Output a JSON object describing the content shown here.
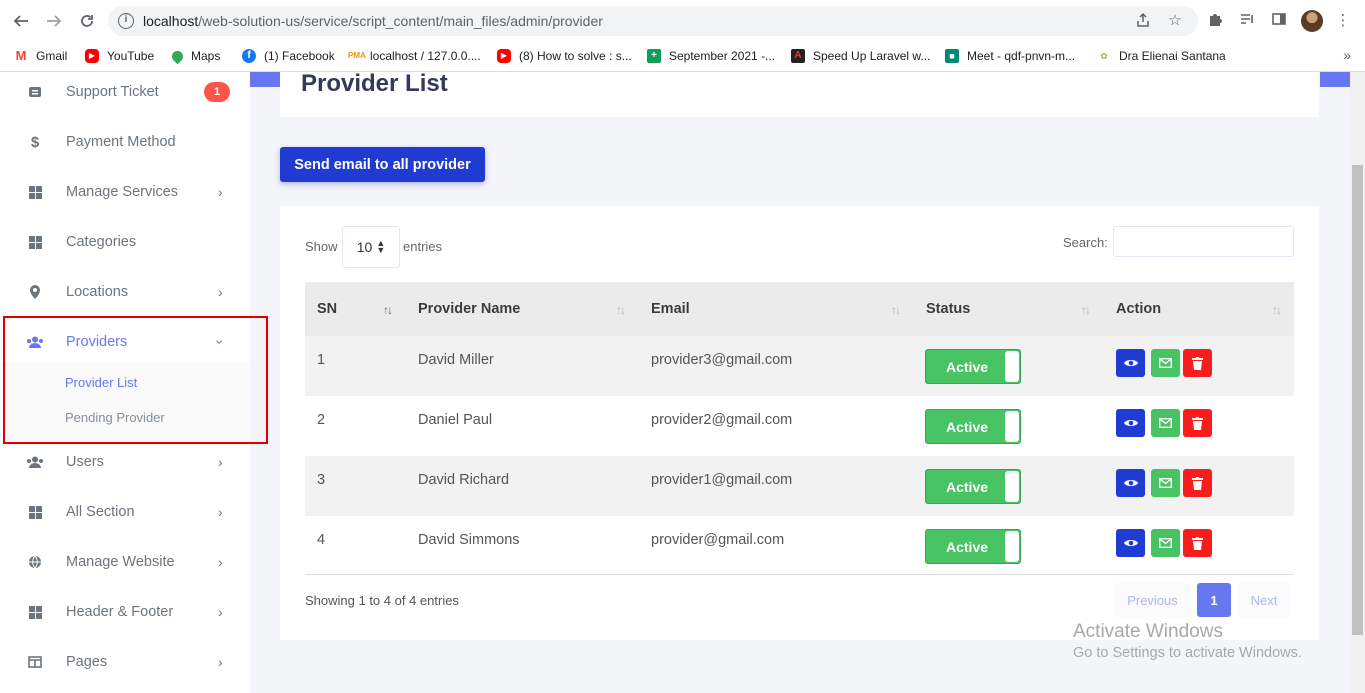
{
  "browser": {
    "url_host": "localhost",
    "url_path": "/web-solution-us/service/script_content/main_files/admin/provider",
    "bookmarks": [
      {
        "label": "Gmail",
        "icon": "gmail-icon",
        "color": "#ea4335"
      },
      {
        "label": "YouTube",
        "icon": "youtube-icon",
        "color": "#ff0000"
      },
      {
        "label": "Maps",
        "icon": "maps-icon",
        "color": "#34a853"
      },
      {
        "label": "(1) Facebook",
        "icon": "facebook-icon",
        "color": "#1877f2"
      },
      {
        "label": "localhost / 127.0.0....",
        "icon": "phpmyadmin-icon",
        "color": "#f29111"
      },
      {
        "label": "(8) How to solve : s...",
        "icon": "youtube-icon",
        "color": "#ff0000"
      },
      {
        "label": "September 2021 -...",
        "icon": "sheets-icon",
        "color": "#0f9d58"
      },
      {
        "label": "Speed Up Laravel w...",
        "icon": "laravel-icon",
        "color": "#222222"
      },
      {
        "label": "Meet - qdf-pnvn-m...",
        "icon": "meet-icon",
        "color": "#00897b"
      },
      {
        "label": "Dra Elienai Santana",
        "icon": "site-icon",
        "color": "#8bc34a"
      }
    ]
  },
  "sidebar": {
    "items": [
      {
        "label": "Support Ticket",
        "icon": "ticket-icon",
        "badge": "1"
      },
      {
        "label": "Payment Method",
        "icon": "dollar-icon"
      },
      {
        "label": "Manage Services",
        "icon": "grid-icon"
      },
      {
        "label": "Categories",
        "icon": "grid-icon"
      },
      {
        "label": "Locations",
        "icon": "map-marker-icon"
      },
      {
        "label": "Providers",
        "icon": "users-icon"
      },
      {
        "label": "Users",
        "icon": "users-icon"
      },
      {
        "label": "All Section",
        "icon": "grid-icon"
      },
      {
        "label": "Manage Website",
        "icon": "globe-icon"
      },
      {
        "label": "Header & Footer",
        "icon": "grid-icon"
      },
      {
        "label": "Pages",
        "icon": "columns-icon"
      }
    ],
    "submenu": {
      "provider_list": "Provider List",
      "pending_provider": "Pending Provider"
    }
  },
  "main": {
    "title": "Provider List",
    "send_email_label": "Send email to all provider",
    "show_label": "Show",
    "entries_value": "10",
    "entries_label": "entries",
    "search_label": "Search:",
    "search_value": "",
    "columns": [
      "SN",
      "Provider Name",
      "Email",
      "Status",
      "Action"
    ],
    "rows": [
      {
        "sn": "1",
        "name": "David Miller",
        "email": "provider3@gmail.com",
        "status": "Active"
      },
      {
        "sn": "2",
        "name": "Daniel Paul",
        "email": "provider2@gmail.com",
        "status": "Active"
      },
      {
        "sn": "3",
        "name": "David Richard",
        "email": "provider1@gmail.com",
        "status": "Active"
      },
      {
        "sn": "4",
        "name": "David Simmons",
        "email": "provider@gmail.com",
        "status": "Active"
      }
    ],
    "info": "Showing 1 to 4 of 4 entries",
    "pagination": {
      "previous": "Previous",
      "current": "1",
      "next": "Next"
    }
  },
  "watermark": {
    "line1": "Activate Windows",
    "line2": "Go to Settings to activate Windows."
  },
  "colors": {
    "primary": "#6777ef",
    "send_button": "#1f3bd1",
    "success": "#47c363",
    "danger": "#fc1c1c",
    "badge": "#fc544b"
  }
}
